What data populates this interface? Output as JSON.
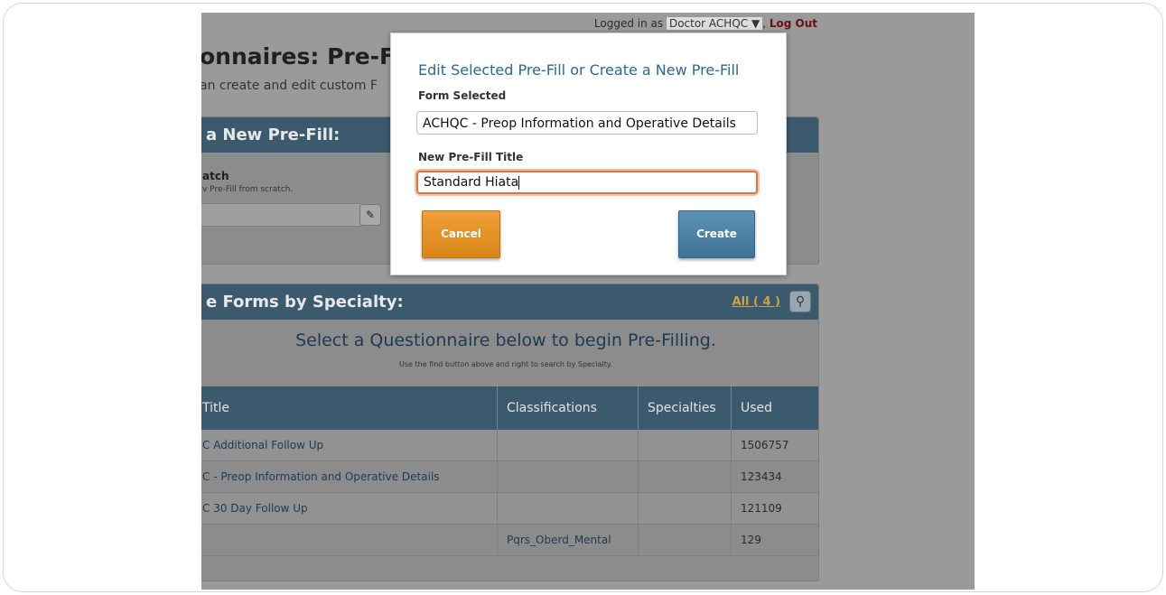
{
  "topbar": {
    "logged_in_prefix": "Logged in as",
    "user": "Doctor ACHQC ▼",
    "separator": ",",
    "logout": "Log Out"
  },
  "page": {
    "title": "onnaires: Pre-Fil",
    "subtitle": "an create and edit custom F"
  },
  "create_panel": {
    "header": "a New Pre-Fill:",
    "option_title": "atch",
    "option_desc": "v Pre-Fill from scratch.",
    "edit_icon": "pencil-icon"
  },
  "forms_panel": {
    "header": "e Forms by Specialty:",
    "all_link": "All ( 4 )",
    "find_icon": "search-icon",
    "select_message": "Select a Questionnaire below to begin Pre-Filling.",
    "select_hint": "Use the find button above and right to search by Specialty.",
    "columns": [
      "Title",
      "Classifications",
      "Specialties",
      "Used"
    ],
    "rows": [
      {
        "title": "C Additional Follow Up",
        "classification": "",
        "specialty": "",
        "used": "1506757"
      },
      {
        "title": "C - Preop Information and Operative Details",
        "classification": "",
        "specialty": "",
        "used": "123434"
      },
      {
        "title": "C 30 Day Follow Up",
        "classification": "",
        "specialty": "",
        "used": "121109"
      },
      {
        "title": "",
        "classification": "Pqrs_Oberd_Mental",
        "specialty": "",
        "used": "129"
      }
    ]
  },
  "modal": {
    "title": "Edit Selected Pre-Fill or Create a New Pre-Fill",
    "form_label": "Form Selected",
    "form_value": "ACHQC - Preop Information and Operative Details",
    "title_label": "New Pre-Fill Title",
    "title_value": "Standard Hiata",
    "cancel_label": "Cancel",
    "create_label": "Create"
  },
  "colors": {
    "accent_orange": "#e1703e",
    "header_blue": "#3c5a6e",
    "create_blue": "#4a80a6",
    "cancel_orange": "#e4901f"
  }
}
